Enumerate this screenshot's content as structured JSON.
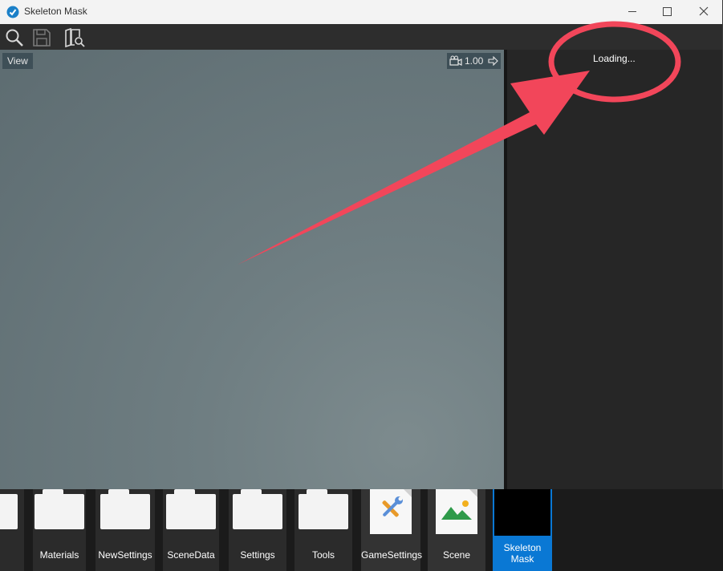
{
  "window": {
    "title": "Skeleton Mask"
  },
  "toolbar": {
    "icons": [
      "search-icon",
      "save-icon",
      "asset-browser-icon"
    ]
  },
  "viewport": {
    "view_label": "View",
    "zoom_value": "1.00"
  },
  "panel": {
    "status_text": "Loading..."
  },
  "assets": {
    "items": [
      {
        "label": "",
        "kind": "folder"
      },
      {
        "label": "Materials",
        "kind": "folder"
      },
      {
        "label": "NewSettings",
        "kind": "folder"
      },
      {
        "label": "SceneData",
        "kind": "folder"
      },
      {
        "label": "Settings",
        "kind": "folder"
      },
      {
        "label": "Tools",
        "kind": "folder"
      },
      {
        "label": "GameSettings",
        "kind": "settings"
      },
      {
        "label": "Scene",
        "kind": "scene"
      },
      {
        "label": "Skeleton Mask",
        "kind": "skeleton-mask"
      }
    ]
  },
  "colors": {
    "annotation": "#f2465a",
    "accent": "#0a78d4"
  }
}
